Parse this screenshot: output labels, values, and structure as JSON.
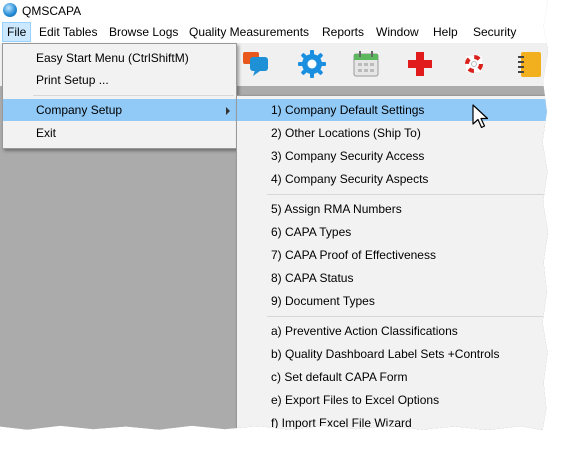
{
  "window": {
    "title": "QMSCAPA"
  },
  "menubar": {
    "items": [
      "File",
      "Edit Tables",
      "Browse Logs",
      "Quality Measurements",
      "Reports",
      "Window",
      "Help",
      "Security"
    ]
  },
  "toolbar": {
    "icons": [
      "chat-bubble-icon",
      "gear-icon",
      "calendar-icon",
      "red-cross-icon",
      "lifebuoy-icon",
      "notebook-icon"
    ]
  },
  "file_menu": {
    "items": [
      {
        "label": "Easy Start Menu (CtrlShiftM)"
      },
      {
        "label": "Print Setup ..."
      },
      {
        "label": "Company Setup",
        "submenu": true,
        "highlighted": true
      },
      {
        "label": "Exit"
      }
    ]
  },
  "company_setup_submenu": {
    "groups": [
      [
        "1) Company Default Settings",
        "2) Other Locations (Ship To)",
        "3) Company Security Access",
        "4) Company Security Aspects"
      ],
      [
        "5) Assign RMA Numbers",
        "6) CAPA Types",
        "7) CAPA Proof of Effectiveness",
        "8) CAPA Status",
        "9) Document Types"
      ],
      [
        "a) Preventive Action Classifications",
        "b) Quality Dashboard Label Sets +Controls",
        "c) Set default CAPA Form",
        "e) Export Files to Excel Options",
        "f) Import Excel File Wizard"
      ]
    ],
    "highlighted": "1) Company Default Settings"
  },
  "colors": {
    "highlight": "#91c9f7",
    "menu_active": "#cce8ff",
    "workspace": "#ababab",
    "menu_bg": "#f2f2f2"
  }
}
